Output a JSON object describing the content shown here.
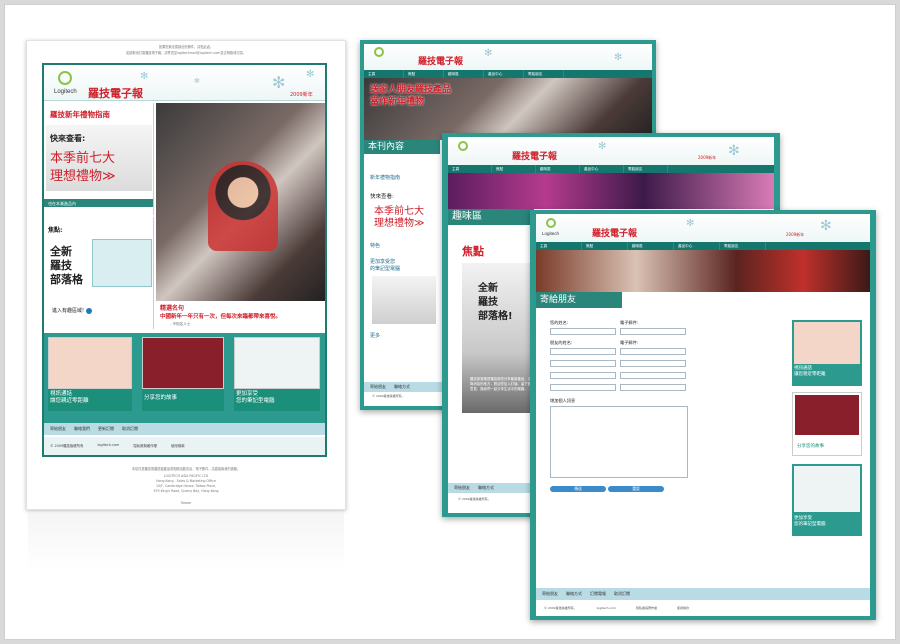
{
  "pages": {
    "p1": {
      "topnote_1": "如果您無法閱讀此份郵件，請點此處。",
      "topnote_2": "如欲取消訂閱羅技電子報，請寄送至logitechmail@logitech.com並註明取消訂閱。",
      "brand": "羅技電子報",
      "logo_text": "Logitech",
      "new_year_tag": "2009新年",
      "gift_guide": "羅技新年禮物指南",
      "quick_look": "快來查看:",
      "top7_line1": "本季前七大",
      "top7_line2": "理想禮物≫",
      "more_products": "也在本漸進品內",
      "focus": "焦點:",
      "blog_line1": "全新",
      "blog_line2": "羅技",
      "blog_line3": "部落格",
      "enter_area": "進入有趣區域!",
      "quote_title": "精選名句",
      "quote_text": "中國新年一年只有一次，但每次來臨都帶來喜悅。",
      "quote_author": "- 不知名人士",
      "card1_text": "視訊通話\n讓您親近零距離",
      "card1_side": "開始選購\n看更多",
      "card2_text": "分享您的故事",
      "card2_side": "開始選購\n看更多",
      "card3_text": "更加享受\n您的筆記型電腦",
      "card3_side": "開始選購\n看更多",
      "strip_items": [
        "寄給朋友",
        "聯絡我們",
        "更新訂閱",
        "取消訂閱"
      ],
      "footer_links": [
        "© 2009羅技版權所有",
        "logitech.com",
        "隱私權與著作權",
        "使用條款"
      ],
      "address_1": "本信件是羅技電腦週邊產品或相關活動訊息，電子郵件，請直接與我們連絡。",
      "address_2": "LOGITECH ASIA PACIFIC LTD",
      "address_3": "Hong Kong - Sales & Marketing Office",
      "address_4": "10/F, Cambridge House, Taikoo Place,",
      "address_5": "979 King's Road, Quarry Bay, Hong Kong",
      "address_6": "Taiwan"
    },
    "p2": {
      "brand": "羅技電子報",
      "nav": [
        "主頁",
        "焦點",
        "趣味區",
        "產品中心",
        "寄給朋友"
      ],
      "headline_1": "送家人朋友羅技產品",
      "headline_2": "當作新年禮物",
      "section": "本刊內容",
      "gift_guide": "新年禮物指南",
      "quick_look": "快來查看:",
      "top7_line1": "本季前七大",
      "top7_line2": "理想禮物≫",
      "feature": "特色",
      "enjoy_1": "更加享受您",
      "enjoy_2": "的筆記型電腦",
      "more": "更多",
      "footer_items": [
        "寄給朋友",
        "聯絡方式"
      ],
      "copyright": "© 2009羅技版權所有。"
    },
    "p3": {
      "brand": "羅技電子報",
      "new_year_tag": "2009新年",
      "nav": [
        "主頁",
        "焦點",
        "趣味區",
        "產品中心",
        "寄給朋友"
      ],
      "section": "趣味區",
      "focus": "焦點",
      "blog_line1": "全新",
      "blog_line2": "羅技",
      "blog_line3": "部落格!",
      "body_text": "羅技部落格是羅技與您分享最新產品、活動與消息的地方，歡迎您加入討論、留下寶貴意見，與我們一起分享生活中的樂趣。",
      "footer_items": [
        "寄給朋友",
        "聯絡方式"
      ],
      "copyright": "© 2009羅技版權所有。"
    },
    "p4": {
      "brand": "羅技電子報",
      "logo_text": "Logitech",
      "new_year_tag": "2009新年",
      "nav": [
        "主頁",
        "焦點",
        "趣味區",
        "產品中心",
        "寄給朋友"
      ],
      "section": "寄給朋友",
      "your_name": "您的姓名:",
      "email": "電子郵件:",
      "friend_name": "朋友的姓名:",
      "friend_email": "電子郵件:",
      "add_message": "增加個人訊息",
      "submit": "傳送",
      "reset": "重設",
      "side1_text": "視訊通話\n讓您親近零距離",
      "side1_cta": "開始選購\n看更多",
      "side2_text": "分享您的故事",
      "side2_cta": "開始選購\n看更多",
      "side3_text": "更加享受\n您的筆記型電腦",
      "side3_cta": "開始選購\n看更多",
      "strip_items": [
        "寄給朋友",
        "聯絡方式",
        "訂閱電報",
        "取消訂閱"
      ],
      "footer_links": [
        "© 2009羅技版權所有。",
        "logitech.com",
        "隱私權與著作權",
        "使用條款"
      ]
    }
  },
  "colors": {
    "teal": "#2c9a8e",
    "dark_teal": "#14766c",
    "brand_red": "#d0202b",
    "green_caption": "#1c8f7a",
    "strip_blue": "#b9dbe4"
  }
}
